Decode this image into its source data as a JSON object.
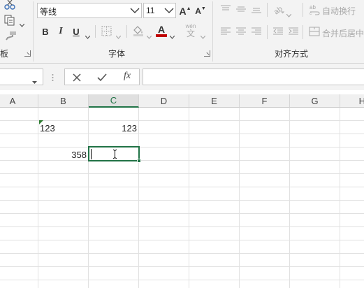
{
  "ribbon": {
    "font_name": "等线",
    "font_size": "11",
    "font_group_label": "字体",
    "clipboard_group_label_partial": "板",
    "alignment_group_label": "对齐方式",
    "wrap_text_label": "自动换行",
    "merge_center_label": "合并后居中",
    "bold_label": "B",
    "italic_label": "I",
    "underline_label": "U",
    "font_color_label": "A",
    "grow_font_label": "A",
    "shrink_font_label": "A",
    "phonetic_label": "wén",
    "phonetic_char": "文",
    "font_color": "#c00000",
    "fx_label": "fx"
  },
  "formula_bar": {
    "name_box": "",
    "formula": ""
  },
  "sheet": {
    "columns": [
      "A",
      "B",
      "C",
      "D",
      "E",
      "F",
      "G",
      "H"
    ],
    "active_column": "C",
    "cells": {
      "B2": "123",
      "C2": "123",
      "B4": "358",
      "C4": ""
    },
    "accent_color": "#217346"
  }
}
